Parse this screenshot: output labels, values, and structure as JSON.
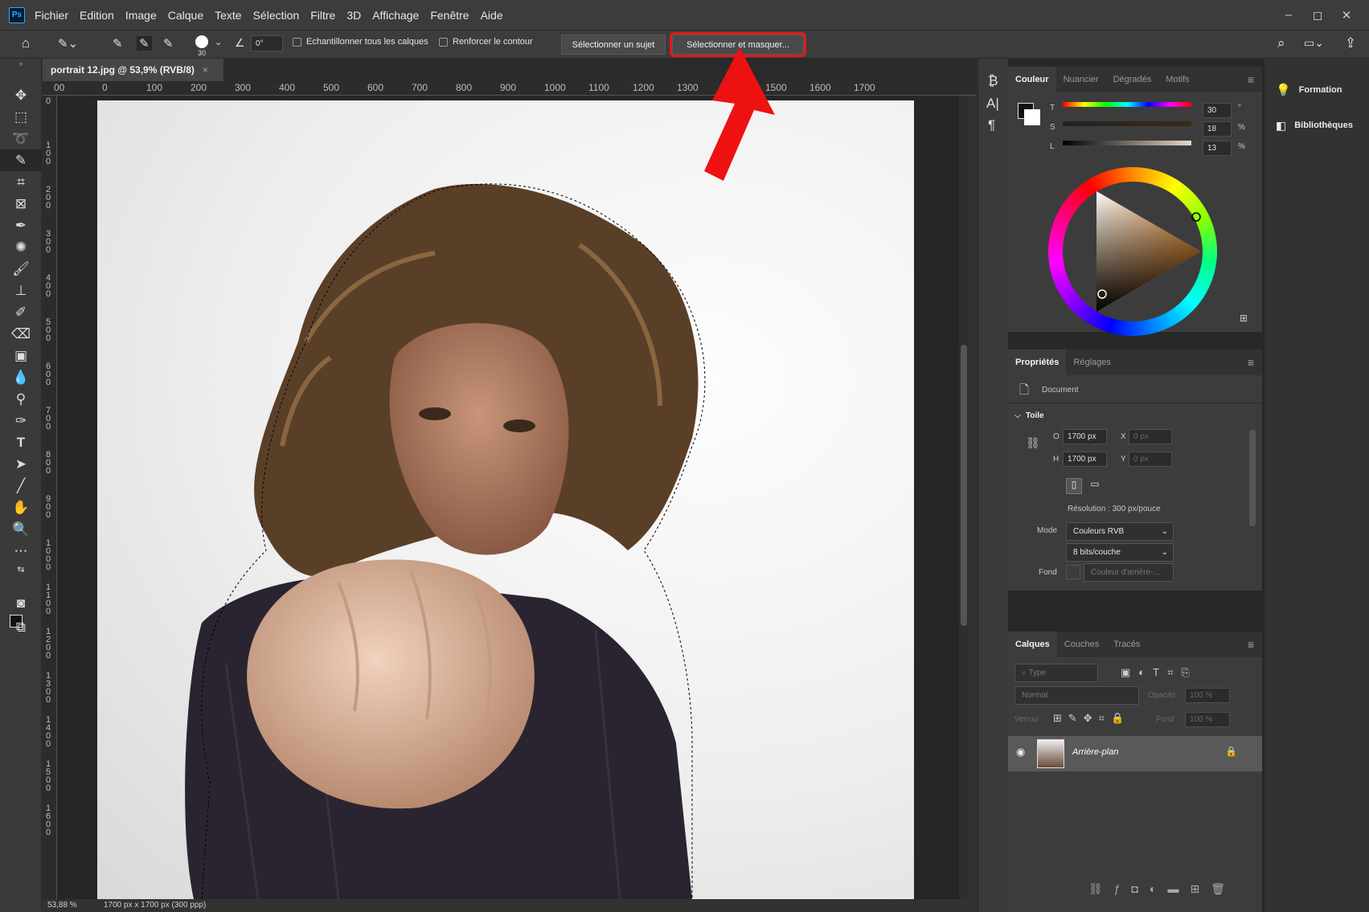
{
  "app": {
    "logo": "Ps"
  },
  "menu": [
    "Fichier",
    "Edition",
    "Image",
    "Calque",
    "Texte",
    "Sélection",
    "Filtre",
    "3D",
    "Affichage",
    "Fenêtre",
    "Aide"
  ],
  "window_controls": [
    "–",
    "◻",
    "✕"
  ],
  "options": {
    "brush_size": "30",
    "angle": "0°",
    "sample_all_layers": "Echantillonner tous les calques",
    "enhance_edge": "Renforcer le contour",
    "select_subject": "Sélectionner un sujet",
    "select_and_mask": "Sélectionner et masquer..."
  },
  "document": {
    "tab_title": "portrait 12.jpg @ 53,9% (RVB/8)",
    "close": "×",
    "zoom": "53,88 %",
    "info": "1700 px x 1700 px (300 ppp)"
  },
  "ruler_top": [
    "00",
    "0",
    "100",
    "200",
    "300",
    "400",
    "500",
    "600",
    "700",
    "800",
    "900",
    "1000",
    "1100",
    "1200",
    "1300",
    "1400",
    "1500",
    "1600",
    "1700"
  ],
  "ruler_left": [
    "0",
    "100",
    "200",
    "300",
    "400",
    "500",
    "600",
    "700",
    "800",
    "900",
    "1000",
    "1100",
    "1200",
    "1300",
    "1400",
    "1500",
    "1600"
  ],
  "color_panel": {
    "tabs": [
      "Couleur",
      "Nuancier",
      "Dégradés",
      "Motifs"
    ],
    "sliders": [
      {
        "label": "T",
        "value": "30",
        "unit": "°"
      },
      {
        "label": "S",
        "value": "18",
        "unit": "%"
      },
      {
        "label": "L",
        "value": "13",
        "unit": "%"
      }
    ]
  },
  "properties_panel": {
    "tabs": [
      "Propriétés",
      "Réglages"
    ],
    "kind": "Document",
    "section": "Toile",
    "width_label": "O",
    "width": "1700 px",
    "height_label": "H",
    "height": "1700 px",
    "x_label": "X",
    "x": "0 px",
    "y_label": "Y",
    "y": "0 px",
    "resolution": "Résolution : 300 px/pouce",
    "mode_label": "Mode",
    "mode": "Couleurs RVB",
    "depth": "8 bits/couche",
    "fill_label": "Fond",
    "fill": "Couleur d'arrière-..."
  },
  "layers_panel": {
    "tabs": [
      "Calques",
      "Couches",
      "Tracés"
    ],
    "filter": "Type",
    "blend": "Normal",
    "opacity_label": "Opacité :",
    "opacity": "100 %",
    "lock_label": "Verrou :",
    "fill_label": "Fond :",
    "fill": "100 %",
    "layer_name": "Arrière-plan"
  },
  "right_panels": [
    "Formation",
    "Bibliothèques"
  ],
  "colors": {
    "accent_red": "#e01a1a",
    "ps_blue": "#31a8ff"
  }
}
